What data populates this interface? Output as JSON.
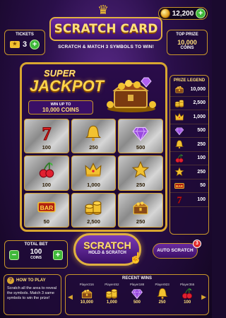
{
  "header": {
    "title": "SCRATCH CARD",
    "subtitle": "SCRATCH & MATCH 3 SYMBOLS TO WIN!",
    "balance": "12,200"
  },
  "tickets": {
    "label": "TICKETS",
    "count": "3"
  },
  "top_prize": {
    "label": "TOP PRIZE",
    "value": "10,000",
    "unit": "COINS"
  },
  "jackpot": {
    "line1": "SUPER",
    "line2": "JACKPOT",
    "win_label": "WIN UP TO",
    "win_value": "10,000 COINS"
  },
  "grid": [
    {
      "symbol": "seven",
      "amount": "100"
    },
    {
      "symbol": "bell",
      "amount": "250"
    },
    {
      "symbol": "diamond",
      "amount": "500"
    },
    {
      "symbol": "cherry",
      "amount": "100"
    },
    {
      "symbol": "crown",
      "amount": "1,000"
    },
    {
      "symbol": "star",
      "amount": "250"
    },
    {
      "symbol": "bar",
      "amount": "50"
    },
    {
      "symbol": "coins",
      "amount": "2,500"
    },
    {
      "symbol": "chest",
      "amount": "250"
    }
  ],
  "prize_legend": {
    "title": "PRIZE LEGEND",
    "rows": [
      {
        "symbol": "chest",
        "value": "10,000"
      },
      {
        "symbol": "coins",
        "value": "2,500"
      },
      {
        "symbol": "crown",
        "value": "1,000"
      },
      {
        "symbol": "diamond",
        "value": "500"
      },
      {
        "symbol": "bell",
        "value": "250"
      },
      {
        "symbol": "cherry",
        "value": "100"
      },
      {
        "symbol": "star",
        "value": "250"
      },
      {
        "symbol": "bar",
        "value": "50"
      },
      {
        "symbol": "seven",
        "value": "100"
      }
    ]
  },
  "bet": {
    "label": "TOTAL BET",
    "value": "100",
    "unit": "COINS",
    "minus": "−",
    "plus": "+"
  },
  "scratch_button": {
    "label": "SCRATCH",
    "sublabel": "HOLD & SCRATCH"
  },
  "auto_scratch": {
    "label": "AUTO SCRATCH",
    "badge": "3"
  },
  "how_to": {
    "title": "HOW TO PLAY",
    "text": "Scratch all the area to reveal the symbols. Match 3 same symbols to win the prize!"
  },
  "recent_wins": {
    "title": "RECENT WINS",
    "items": [
      {
        "player": "Player316",
        "symbol": "chest",
        "value": "10,000"
      },
      {
        "player": "Player452",
        "symbol": "coins",
        "value": "1,000"
      },
      {
        "player": "Player188",
        "symbol": "diamond",
        "value": "500"
      },
      {
        "player": "Player923",
        "symbol": "bell",
        "value": "250"
      },
      {
        "player": "Player355",
        "symbol": "cherry",
        "value": "100"
      }
    ]
  }
}
